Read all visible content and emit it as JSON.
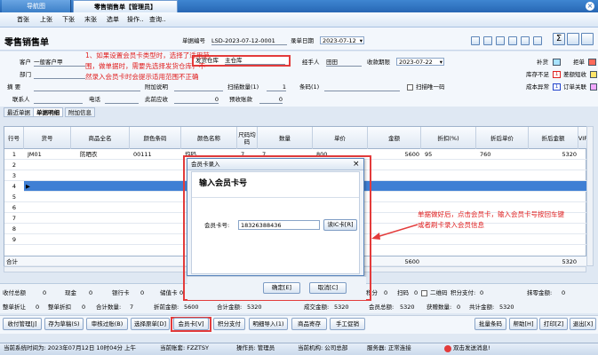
{
  "tabs": [
    {
      "label": "导航图"
    },
    {
      "label": "零售销售单【管理员】"
    }
  ],
  "close_icon": "×",
  "toolbar": [
    "首张",
    "上张",
    "下张",
    "末张",
    "选单",
    "操作..",
    "查询.."
  ],
  "page_title": "零售销售单",
  "header": {
    "bill_no_label": "单据编号",
    "bill_no": "LSD-2023-07-12-0001",
    "bill_date_label": "录单日期",
    "bill_date": "2023-07-12",
    "customer_label": "客户",
    "customer": "一般客户甲",
    "warehouse_label": "发货仓库",
    "warehouse": "主仓库",
    "handler_label": "经手人",
    "handler": "田田",
    "collect_label": "收款期限",
    "collect_date": "2023-07-22",
    "dept_label": "部门",
    "summary_label": "摘   要",
    "remark_label": "附加说明",
    "scan_qty_label": "扫描数量(1)",
    "scan_qty": "1",
    "barcode_label": "条码(1)",
    "scan_one_label": "扫描唯一码",
    "contact_label": "联系人",
    "phone_label": "电话",
    "cur_collect_label": "此前应收",
    "cur_collect": "0",
    "prepay_label": "预收账款",
    "prepay": "0",
    "right_labels": [
      "补货",
      "拒单",
      "库存不足",
      "差额短收",
      "成本异常",
      "订单关联"
    ]
  },
  "annotation_1": "1、如果设置会员卡类型时，选择了适用范围，做单据时，需要先选择发货仓库，不然录入会员卡时会提示适用范围不正确",
  "annotation_2": "单据做好后，点击会员卡，输入会员卡号按回车键或者刷卡录入会员信息",
  "subtabs": [
    "最近单据",
    "单据明细",
    "附加信息"
  ],
  "grid": {
    "columns": [
      "行号",
      "货号",
      "商品全名",
      "颜色条码",
      "颜色名称",
      "尺码均码",
      "数量",
      "单价",
      "金额",
      "折扣(%)",
      "折后单价",
      "折后金额",
      "VIP"
    ],
    "rows": [
      {
        "n": "1",
        "code": "JM01",
        "name": "防晒衣",
        "color_code": "00111",
        "color": "均码",
        "size": "7",
        "qty": "7",
        "price": "800",
        "amount": "5600",
        "disc": "95",
        "dprice": "760",
        "damount": "5320"
      },
      {
        "n": "2"
      },
      {
        "n": "3"
      },
      {
        "n": "4"
      },
      {
        "n": "5"
      },
      {
        "n": "6"
      },
      {
        "n": "7"
      },
      {
        "n": "8"
      },
      {
        "n": "9"
      }
    ],
    "total_label": "合计",
    "total_amount": "5600",
    "total_damount": "5320"
  },
  "totals": {
    "line1": [
      "收付总额",
      "0",
      "现金",
      "0",
      "银行卡",
      "0",
      "储值卡",
      "0",
      "积分",
      "0",
      "扫码",
      "0",
      "二维码",
      "积分支付:",
      "0",
      "抹零金额:",
      "0"
    ],
    "line2": [
      "整单折让",
      "0",
      "整单折扣",
      "0",
      "合计数量:",
      "7",
      "折前金额:",
      "5600",
      "合计金额:",
      "5320",
      "成交金额:",
      "5320",
      "会员总额:",
      "5320",
      "获赠数量:",
      "0",
      "共计金额:",
      "5320"
    ]
  },
  "buttons": [
    "收付管理[J]",
    "存为草稿(S)",
    "审核过账(B)",
    "选择原单[D]",
    "会员卡[V]",
    "积分支付",
    "明细导入(1)",
    "商品寄存",
    "手工促销",
    "批量条码",
    "帮助[H]",
    "打印[Z]",
    "退出[X]"
  ],
  "status": {
    "time": "当前系统时间为: 2023年07月12日 10时04分 上午",
    "account": "当前账套: FZZTSY",
    "operator": "操作员: 管理员",
    "org": "当前机构: 公司总部",
    "server": "服务器: 正常连接",
    "msg": "双击发送消息!"
  },
  "dialog": {
    "title": "会员卡录入",
    "heading": "输入会员卡号",
    "card_label": "会员卡号:",
    "card_value": "18326388436",
    "read_btn": "读IC卡[R]",
    "ok_btn": "确定[E]",
    "cancel_btn": "取消[C]"
  },
  "colors": {
    "accent": "#2767b4",
    "red": "#e33b3b"
  }
}
